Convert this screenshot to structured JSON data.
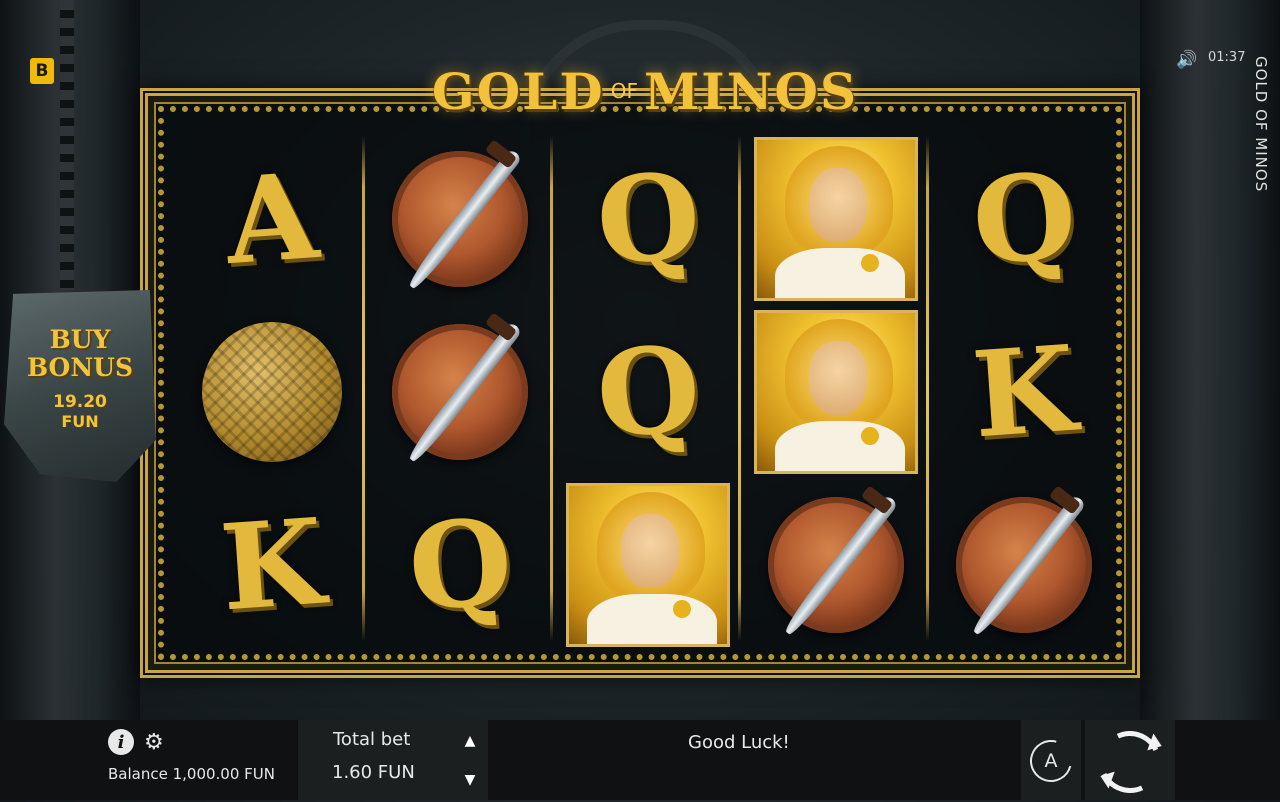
{
  "brand": {
    "badge_letter": "B",
    "badge_color": "#f0b90b"
  },
  "status": {
    "sound_icon": "speaker-icon",
    "time": "01:37"
  },
  "game": {
    "title": "GOLD OF MINOS",
    "side_title": "GOLD OF MINOS",
    "logo_left": "GOLD",
    "logo_mid": "OF",
    "logo_right": "MINOS"
  },
  "buy_bonus": {
    "title": "BUY\nBONUS",
    "price": "19.20",
    "currency": "FUN"
  },
  "reels": [
    [
      "A",
      "yarn-ball",
      "K"
    ],
    [
      "shield-dagger",
      "shield-dagger",
      "Q"
    ],
    [
      "Q",
      "Q",
      "hero"
    ],
    [
      "hero",
      "hero",
      "shield-dagger"
    ],
    [
      "Q",
      "K",
      "shield-dagger"
    ]
  ],
  "bottom": {
    "info_icon": "info-icon",
    "settings_icon": "gear-icon",
    "balance_label": "Balance 1,000.00 FUN",
    "total_bet_label": "Total bet",
    "total_bet_value": "1.60 FUN",
    "message": "Good Luck!",
    "auto_label": "A",
    "spin_icon": "spin-icon"
  },
  "colors": {
    "gold": "#e2b93c",
    "frame": "#c9a540",
    "bar": "#0f1112"
  }
}
